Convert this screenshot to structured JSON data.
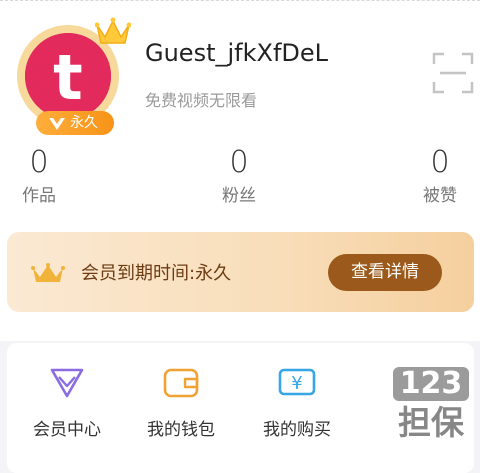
{
  "profile": {
    "username": "Guest_jfkXfDeL",
    "slogan": "免费视频无限看",
    "badge_label": "永久",
    "avatar_letter": "t"
  },
  "stats": [
    {
      "count": "0",
      "label": "作品"
    },
    {
      "count": "0",
      "label": "粉丝"
    },
    {
      "count": "0",
      "label": "被赞"
    }
  ],
  "vip": {
    "expire_text": "会员到期时间:永久",
    "detail_button": "查看详情"
  },
  "menu": [
    {
      "label": "会员中心",
      "icon": "diamond-icon"
    },
    {
      "label": "我的钱包",
      "icon": "wallet-icon"
    },
    {
      "label": "我的购买",
      "icon": "purchase-icon"
    }
  ],
  "watermark": {
    "number": "123",
    "text": "担保"
  },
  "colors": {
    "avatar": "#e22a5d",
    "badge": "#f79318",
    "vip_button": "#9b5a1c",
    "diamond_icon": "#8a6ce0",
    "wallet_icon": "#f0a232",
    "purchase_icon": "#35a6e6"
  }
}
